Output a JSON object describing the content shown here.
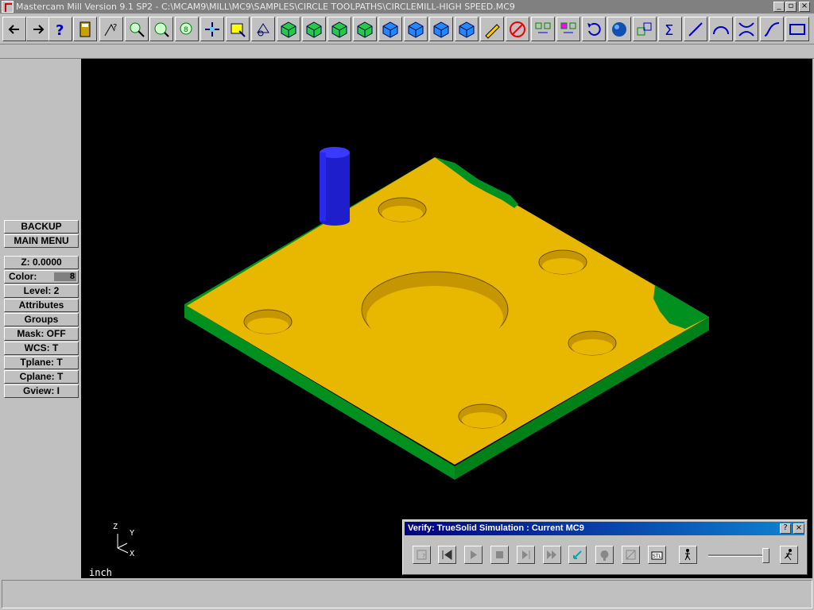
{
  "window": {
    "title": "Mastercam Mill Version 9.1 SP2 - C:\\MCAM9\\MILL\\MC9\\SAMPLES\\CIRCLE TOOLPATHS\\CIRCLEMILL-HIGH SPEED.MC9",
    "controls": {
      "minimize": "_",
      "restore": "▫",
      "close": "×"
    }
  },
  "toolbar": {
    "buttons": [
      {
        "name": "back-arrow-icon"
      },
      {
        "name": "forward-arrow-icon"
      },
      {
        "name": "help-question-icon"
      },
      {
        "name": "calculator-icon"
      },
      {
        "name": "analyze-icon"
      },
      {
        "name": "zoom-window-icon"
      },
      {
        "name": "unzoom-icon"
      },
      {
        "name": "zoom-target-icon"
      },
      {
        "name": "pan-icon"
      },
      {
        "name": "fit-screen-icon"
      },
      {
        "name": "rotate-view-icon"
      },
      {
        "name": "view-cube-iso-icon"
      },
      {
        "name": "view-cube-top-icon"
      },
      {
        "name": "view-cube-front-icon"
      },
      {
        "name": "view-cube-side-icon"
      },
      {
        "name": "gview-cube-1-icon"
      },
      {
        "name": "gview-cube-2-icon"
      },
      {
        "name": "gview-cube-3-icon"
      },
      {
        "name": "gview-cube-4-icon"
      },
      {
        "name": "toolpath-pencil-icon"
      },
      {
        "name": "no-toolpath-icon"
      },
      {
        "name": "operations-icon"
      },
      {
        "name": "nci-icon"
      },
      {
        "name": "undo-icon"
      },
      {
        "name": "shade-sphere-icon"
      },
      {
        "name": "layers-icon"
      },
      {
        "name": "sum-icon"
      },
      {
        "name": "create-line-icon"
      },
      {
        "name": "create-arc-icon"
      },
      {
        "name": "trim-icon"
      },
      {
        "name": "spline-icon"
      },
      {
        "name": "rectangle-icon"
      }
    ]
  },
  "menu": {
    "backup": "BACKUP",
    "main_menu": "MAIN MENU",
    "z": "Z:  0.0000",
    "color_label": "Color:",
    "color_value": "8",
    "level": "Level:  2",
    "attributes": "Attributes",
    "groups": "Groups",
    "mask": "Mask:  OFF",
    "wcs": "WCS:   T",
    "tplane": "Tplane:  T",
    "cplane": "Cplane:  T",
    "gview": "Gview:   I"
  },
  "viewport": {
    "units": "inch",
    "axis_z": "Z",
    "axis_y": "Y",
    "axis_x": "X",
    "colors": {
      "stock_top": "#e8b800",
      "stock_side": "#009020",
      "tool": "#1e1ecc",
      "background": "#000000"
    }
  },
  "verify": {
    "title": "Verify: TrueSolid Simulation : Current MC9",
    "help": "?",
    "close": "×",
    "buttons": [
      {
        "name": "parameters-icon"
      },
      {
        "name": "rewind-icon"
      },
      {
        "name": "play-icon"
      },
      {
        "name": "stop-icon"
      },
      {
        "name": "step-icon"
      },
      {
        "name": "fast-forward-icon"
      },
      {
        "name": "cursor-icon"
      },
      {
        "name": "tool-display-icon"
      },
      {
        "name": "check-icon"
      },
      {
        "name": "save-stl-icon"
      },
      {
        "name": "walker-icon"
      },
      {
        "name": "runner-icon"
      }
    ]
  }
}
